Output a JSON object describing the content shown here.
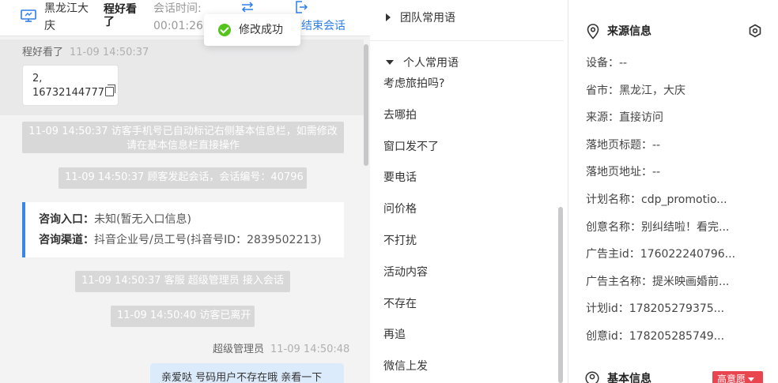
{
  "header": {
    "region": "黑龙江大庆",
    "visitor_name": "程好看了",
    "session_time_label": "会话时间:",
    "session_time_value": "00:01:26",
    "end_label": "结束会话"
  },
  "toast": {
    "text": "修改成功"
  },
  "messages": {
    "visitor_name": "程好看了",
    "visitor_time": "11-09 14:50:37",
    "visitor_line1": "2,",
    "visitor_line2": "16732144777",
    "system": [
      "11-09 14:50:37 访客手机号已自动标记右侧基本信息栏，如需修改请在基本信息栏直接操作",
      "11-09 14:50:37 顾客发起会话，会话编号：40796",
      "11-09 14:50:37 客服 超级管理员 接入会话",
      "11-09 14:50:40 访客已离开"
    ],
    "consult_entry_label": "咨询入口：",
    "consult_entry_value": "未知(暂无入口信息)",
    "consult_channel_label": "咨询渠道：",
    "consult_channel_value": "抖音企业号/员工号(抖音号ID：2839502213)",
    "agent_name": "超级管理员",
    "agent_time": "11-09 14:50:48",
    "agent_text": "亲爱哒 号码用户不存在哦 亲看一下"
  },
  "phrases": {
    "team_group": "团队常用语",
    "personal_group": "个人常用语",
    "items": [
      "考虑旅拍吗?",
      "去哪拍",
      "窗口发不了",
      "要电话",
      "问价格",
      "不打扰",
      "活动内容",
      "不存在",
      "再追",
      "微信上发"
    ]
  },
  "info": {
    "source_title": "来源信息",
    "rows": [
      "设备：--",
      "省市：黑龙江，大庆",
      "来源：直接访问",
      "落地页标题：--",
      "落地页地址：--",
      "计划名称：cdp_promotio...",
      "创意名称：别纠结啦！看完...",
      "广告主id：176022240796...",
      "广告主名称：提米映画婚前...",
      "计划id：178205279375...",
      "创意id：178205285749..."
    ],
    "basic_title": "基本信息",
    "intent_badge": "高意愿"
  },
  "colors": {
    "accent": "#2d7fea",
    "success": "#52c41a",
    "badge": "#e8454f",
    "agent_bubble": "#dcebfb"
  }
}
